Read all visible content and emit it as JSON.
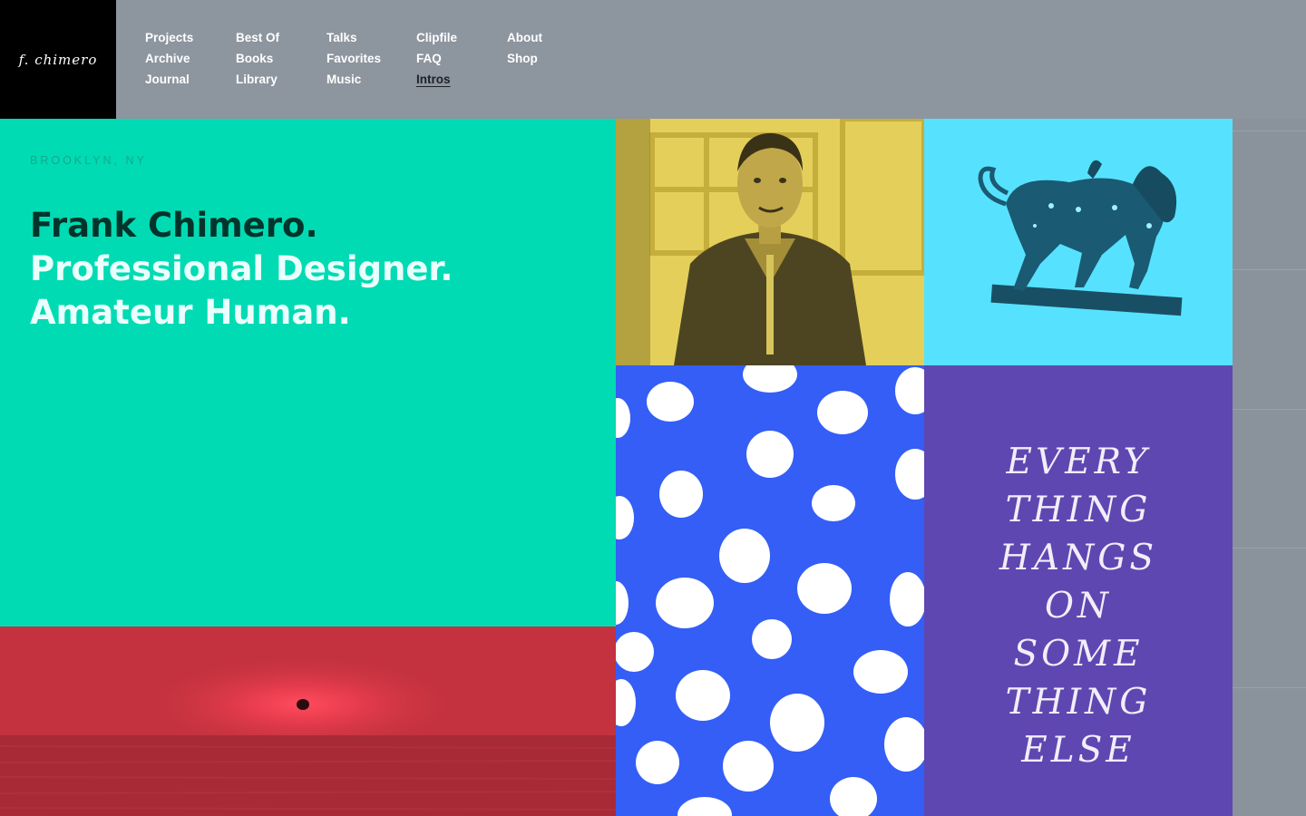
{
  "logo": {
    "text": "f. chimero"
  },
  "nav": {
    "columns": [
      [
        {
          "label": "Projects"
        },
        {
          "label": "Archive"
        },
        {
          "label": "Journal"
        }
      ],
      [
        {
          "label": "Best Of"
        },
        {
          "label": "Books"
        },
        {
          "label": "Library"
        }
      ],
      [
        {
          "label": "Talks"
        },
        {
          "label": "Favorites"
        },
        {
          "label": "Music"
        }
      ],
      [
        {
          "label": "Clipfile"
        },
        {
          "label": "FAQ"
        },
        {
          "label": "Intros"
        }
      ],
      [
        {
          "label": "About"
        },
        {
          "label": "Shop"
        }
      ]
    ],
    "active": "Intros"
  },
  "hero": {
    "location": "BROOKLYN, NY",
    "line1": "Frank Chimero.",
    "line2": "Professional Designer.",
    "line3": "Amateur Human."
  },
  "tiles": {
    "quote_lines": [
      "EVERY",
      "THING",
      "HANGS",
      "ON",
      "SOME",
      "THING",
      "ELSE"
    ]
  },
  "colors": {
    "header_bg": "#8d959f",
    "hero_bg": "#00dbb4",
    "portrait_bg": "#e4cf5a",
    "chimera_bg": "#56e2ff",
    "dots_bg": "#345ef6",
    "quote_bg": "#5f47b1",
    "sunset_bg": "#c3323e"
  }
}
